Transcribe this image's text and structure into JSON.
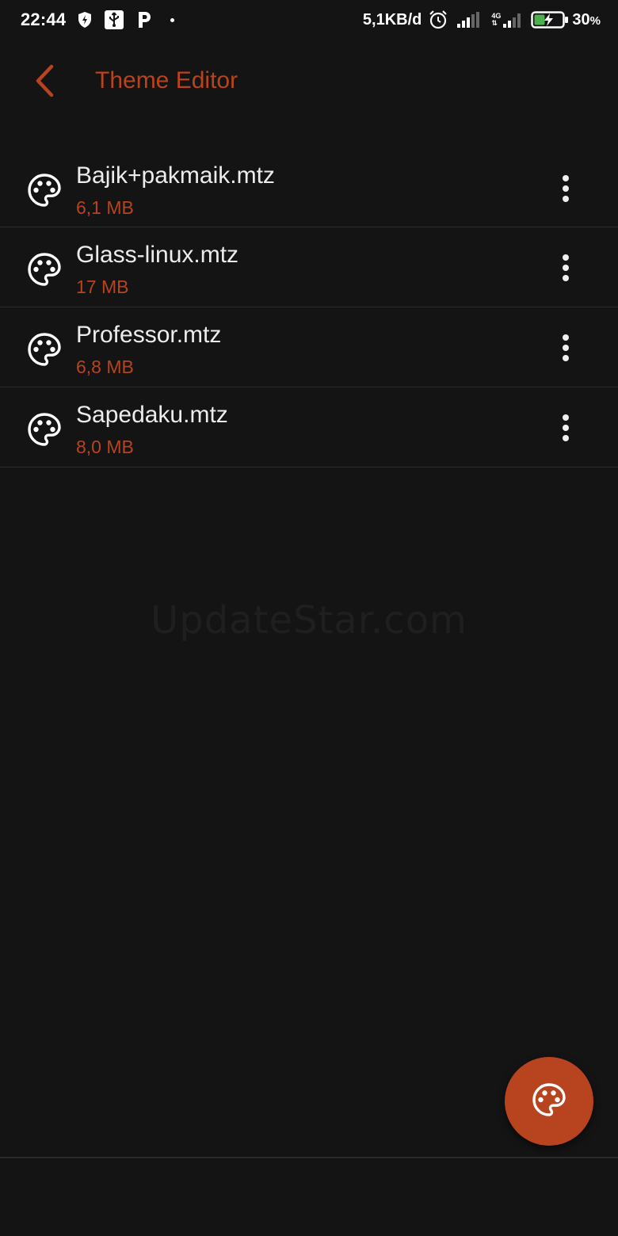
{
  "status_bar": {
    "time": "22:44",
    "network_speed": "5,1KB/d",
    "network_type": "4G",
    "battery_percent": "30",
    "battery_unit": "%",
    "icons": [
      "shield-icon",
      "usb-icon",
      "parking-icon",
      "alarm-icon",
      "signal-icon",
      "signal-4g-icon",
      "battery-charging-icon"
    ]
  },
  "toolbar": {
    "title": "Theme Editor",
    "back_icon": "chevron-left-icon"
  },
  "files": [
    {
      "name": "Bajik+pakmaik.mtz",
      "size": "6,1 MB",
      "icon": "palette-icon"
    },
    {
      "name": "Glass-linux.mtz",
      "size": "17 MB",
      "icon": "palette-icon"
    },
    {
      "name": "Professor.mtz",
      "size": "6,8 MB",
      "icon": "palette-icon"
    },
    {
      "name": "Sapedaku.mtz",
      "size": "8,0 MB",
      "icon": "palette-icon"
    }
  ],
  "watermark": "UpdateStar.com",
  "fab": {
    "icon": "palette-icon"
  },
  "colors": {
    "background": "#141414",
    "accent": "#b8431f",
    "text_primary": "#ececec",
    "divider": "#2b2b2b"
  }
}
